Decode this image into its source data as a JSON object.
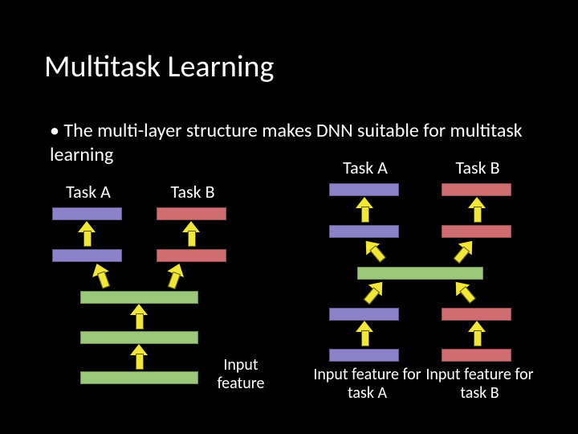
{
  "title": "Multitask Learning",
  "bullet": "The multi-layer structure makes DNN suitable for multitask learning",
  "left": {
    "task_a": "Task A",
    "task_b": "Task B",
    "input": "Input feature"
  },
  "right": {
    "task_a": "Task A",
    "task_b": "Task B",
    "input_a": "Input feature for task A",
    "input_b": "Input feature for task B"
  },
  "colors": {
    "purple": "#8b82c9",
    "red": "#cf6d71",
    "green": "#9bc87a",
    "arrow": "#f2e637"
  }
}
